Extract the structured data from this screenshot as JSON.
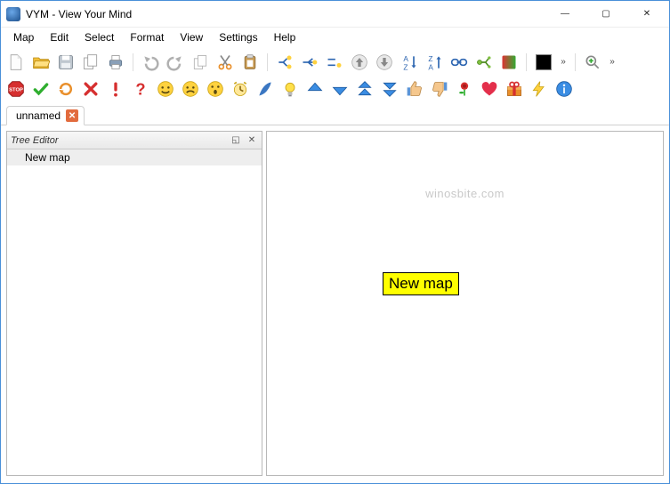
{
  "window": {
    "title": "VYM - View Your Mind",
    "minimize": "—",
    "maximize": "▢",
    "close": "✕"
  },
  "menus": [
    "Map",
    "Edit",
    "Select",
    "Format",
    "View",
    "Settings",
    "Help"
  ],
  "toolbarRow1": {
    "icons": [
      "new-file-icon",
      "open-file-icon",
      "save-icon",
      "copy-map-icon",
      "print-icon",
      "SEP",
      "undo-icon",
      "redo-icon",
      "copy-icon",
      "cut-icon",
      "paste-icon",
      "SEP",
      "add-branch-star-icon",
      "add-child-branch-icon",
      "add-sibling-branch-icon",
      "up-arrow-icon",
      "down-arrow-icon",
      "sort-az-icon",
      "sort-za-icon",
      "link-icon",
      "subtree-icon",
      "gradient-swatch-icon",
      "SEP",
      "color-swatch",
      "chevrons",
      "SEP",
      "zoom-in-icon",
      "chevrons"
    ]
  },
  "toolbarRow2": {
    "icons": [
      "stop-sign-icon",
      "green-check-icon",
      "refresh-orange-icon",
      "red-x-icon",
      "exclamation-icon",
      "question-red-icon",
      "smiley-happy-icon",
      "smiley-sad-icon",
      "smiley-surprised-icon",
      "alarm-clock-icon",
      "feather-icon",
      "lightbulb-icon",
      "arrow-up-blue-icon",
      "arrow-down-blue-icon",
      "double-up-blue-icon",
      "double-down-blue-icon",
      "thumbs-up-icon",
      "thumbs-down-icon",
      "rose-icon",
      "heart-icon",
      "gift-icon",
      "lightning-icon",
      "info-icon"
    ]
  },
  "tab": {
    "label": "unnamed"
  },
  "treeEditor": {
    "title": "Tree Editor",
    "items": [
      "New map"
    ]
  },
  "canvas": {
    "watermark": "winosbite.com",
    "rootNode": "New map"
  }
}
